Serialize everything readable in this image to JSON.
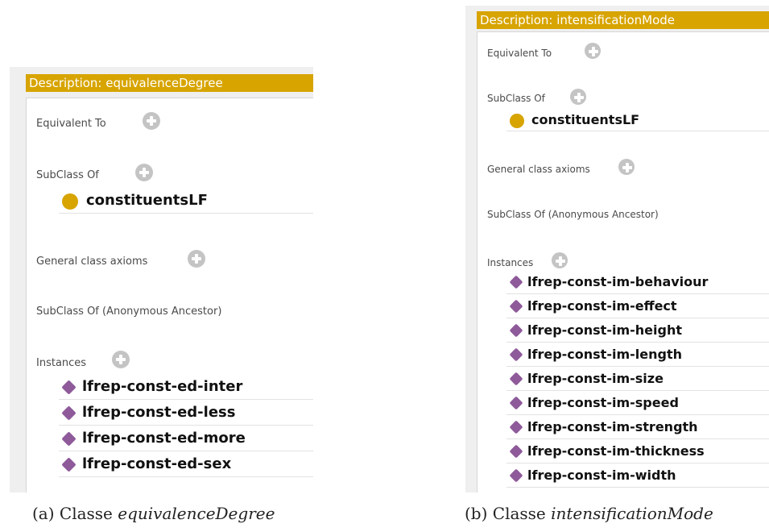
{
  "panel_a": {
    "title": "Description: equivalenceDegree",
    "equivalent_to_label": "Equivalent To",
    "subclass_of_label": "SubClass Of",
    "superclass": "constituentsLF",
    "general_axioms_label": "General class axioms",
    "anonymous_ancestor_label": "SubClass Of (Anonymous Ancestor)",
    "instances_label": "Instances",
    "instances": [
      "lfrep-const-ed-inter",
      "lfrep-const-ed-less",
      "lfrep-const-ed-more",
      "lfrep-const-ed-sex"
    ]
  },
  "panel_b": {
    "title": "Description: intensificationMode",
    "equivalent_to_label": "Equivalent To",
    "subclass_of_label": "SubClass Of",
    "superclass": "constituentsLF",
    "general_axioms_label": "General class axioms",
    "anonymous_ancestor_label": "SubClass Of (Anonymous Ancestor)",
    "instances_label": "Instances",
    "instances": [
      "lfrep-const-im-behaviour",
      "lfrep-const-im-effect",
      "lfrep-const-im-height",
      "lfrep-const-im-length",
      "lfrep-const-im-size",
      "lfrep-const-im-speed",
      "lfrep-const-im-strength",
      "lfrep-const-im-thickness",
      "lfrep-const-im-width"
    ]
  },
  "captions": {
    "a_prefix": "(a) Classe ",
    "a_name": "equivalenceDegree",
    "b_prefix": "(b) Classe ",
    "b_name": "intensificationMode"
  },
  "colors": {
    "title_bar": "#d7a400",
    "class_dot": "#d7a400",
    "instance_diamond": "#8e5a9a",
    "plus_button": "#c4c4c4"
  },
  "icons": {
    "add": "plus-circle-icon",
    "class": "class-dot-icon",
    "individual": "individual-diamond-icon"
  }
}
